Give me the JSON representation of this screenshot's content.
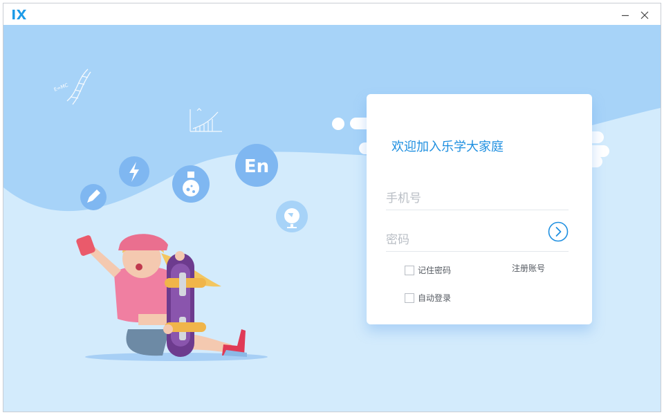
{
  "titlebar": {
    "logo_icon": "ix-logo-icon",
    "minimize_icon": "minimize-icon",
    "close_icon": "close-icon"
  },
  "illustration": {
    "formula_text": "E=MC",
    "subject_icons": [
      "pencil-icon",
      "lightning-icon",
      "flask-icon",
      "english-icon",
      "globe-icon"
    ],
    "english_badge": "En"
  },
  "login": {
    "title": "欢迎加入乐学大家庭",
    "phone_placeholder": "手机号",
    "password_placeholder": "密码",
    "phone_value": "",
    "password_value": "",
    "submit_icon": "chevron-right-circle-icon",
    "remember_label": "记住密码",
    "auto_login_label": "自动登录",
    "register_label": "注册账号",
    "remember_checked": false,
    "auto_login_checked": false
  },
  "colors": {
    "accent": "#1e8fe0",
    "sky_dark": "#a7d3f8",
    "sky_light": "#d3ebfc",
    "icon_circle": "#7fb7f1"
  }
}
